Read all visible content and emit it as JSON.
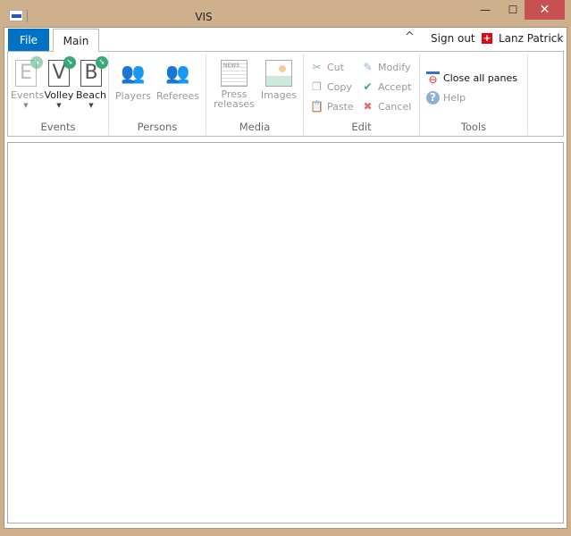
{
  "window": {
    "title": "VIS",
    "minimize": "—",
    "maximize": "☐",
    "close": "✕"
  },
  "tabs": {
    "file": "File",
    "main": "Main"
  },
  "header": {
    "collapse_icon": "^",
    "sign_out": "Sign out",
    "user": "Lanz Patrick",
    "flag": "swiss-flag"
  },
  "ribbon": {
    "events": {
      "label": "Events",
      "items": [
        {
          "letter": "E",
          "label": "Events"
        },
        {
          "letter": "V",
          "label": "Volley"
        },
        {
          "letter": "B",
          "label": "Beach"
        }
      ]
    },
    "persons": {
      "label": "Persons",
      "items": [
        "Players",
        "Referees"
      ]
    },
    "media": {
      "label": "Media",
      "press": "Press releases",
      "press_icon_text": "NEWS",
      "images": "Images"
    },
    "edit": {
      "label": "Edit",
      "cut": "Cut",
      "copy": "Copy",
      "paste": "Paste",
      "modify": "Modify",
      "accept": "Accept",
      "cancel": "Cancel"
    },
    "tools": {
      "label": "Tools",
      "close_all": "Close all panes",
      "help": "Help"
    }
  },
  "colors": {
    "file_tab": "#0072c6",
    "close": "#c75050",
    "frame": "#cfb08c",
    "badge": "#3aa876"
  }
}
